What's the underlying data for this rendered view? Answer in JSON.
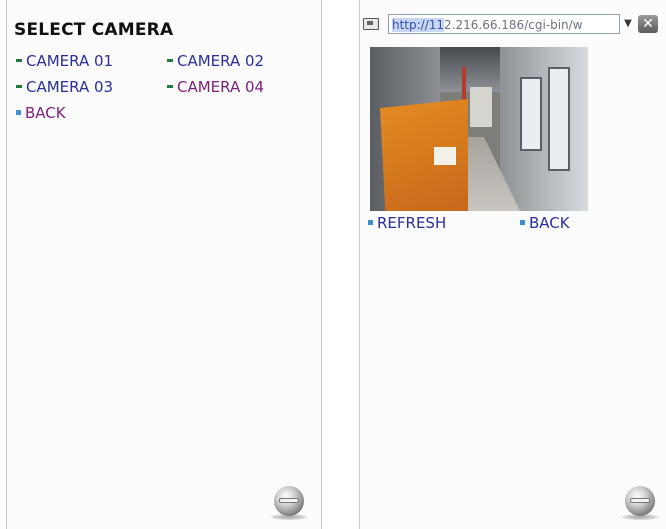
{
  "left_screen": {
    "title": "SELECT CAMERA",
    "cameras": [
      {
        "label": "CAMERA 01",
        "visited": false
      },
      {
        "label": "CAMERA 02",
        "visited": false
      },
      {
        "label": "CAMERA 03",
        "visited": false
      },
      {
        "label": "CAMERA 04",
        "visited": true
      }
    ],
    "back_label": "BACK"
  },
  "right_screen": {
    "url_selected": "http://11",
    "url_rest": "2.216.66.186/cgi-bin/w",
    "close_glyph": "✕",
    "dropdown_glyph": "▼",
    "refresh_label": "REFRESH",
    "back_label": "BACK"
  },
  "colors": {
    "link": "#2b2f9a",
    "visited_link": "#7a1f7a",
    "door": "#e38c22"
  },
  "icons": [
    "page-icon",
    "dropdown-arrow-icon",
    "close-icon",
    "menu-ball-icon",
    "bullet-icon"
  ]
}
